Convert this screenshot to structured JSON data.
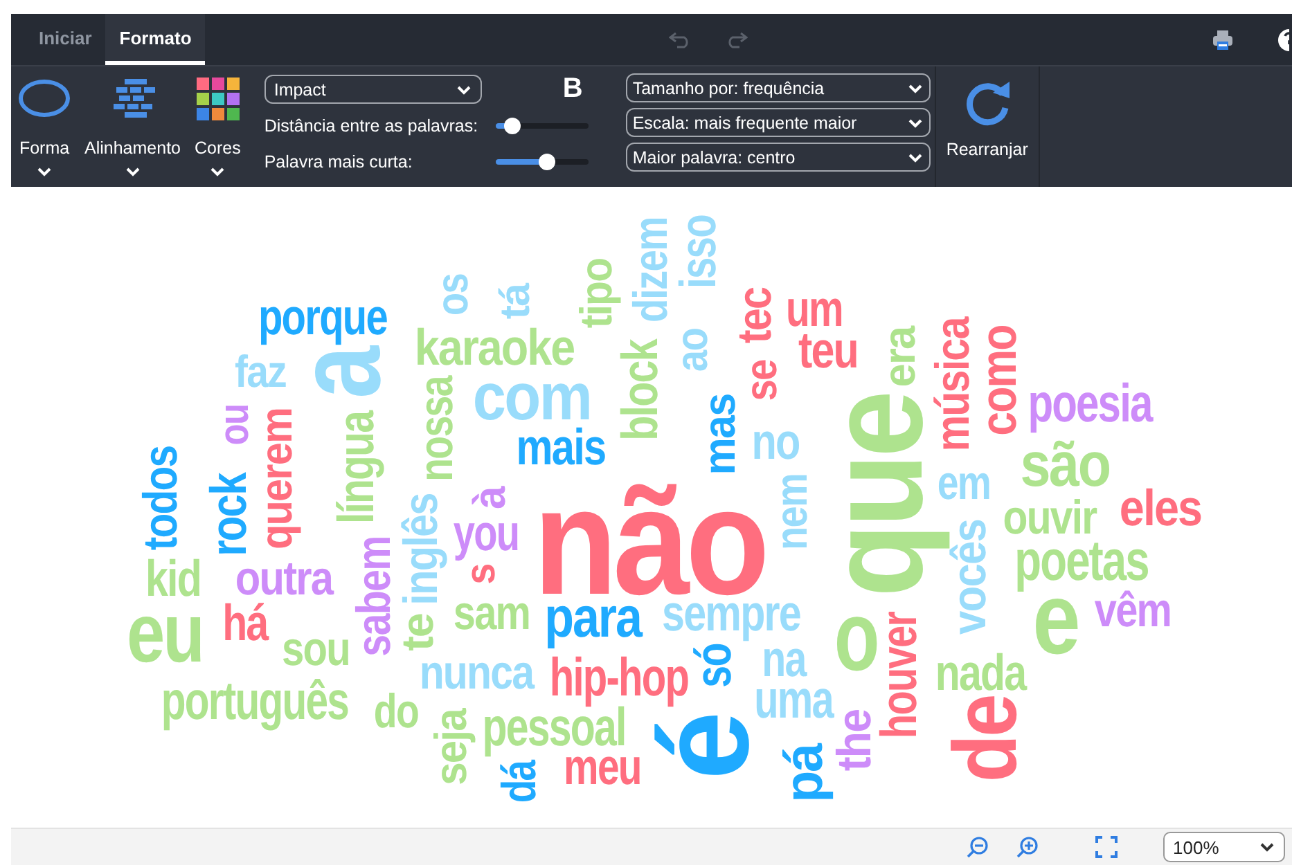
{
  "tabs": [
    {
      "label": "Iniciar",
      "selected": false
    },
    {
      "label": "Formato",
      "selected": true
    }
  ],
  "ribbon": {
    "tools": [
      {
        "label": "Forma",
        "kind": "shape"
      },
      {
        "label": "Alinhamento",
        "kind": "alignment"
      },
      {
        "label": "Cores",
        "kind": "colors"
      }
    ],
    "font": "Impact",
    "bold": "B",
    "sliders": [
      {
        "label": "Distância entre as palavras:",
        "level": 0.18
      },
      {
        "label": "Palavra mais curta:",
        "level": 0.55
      }
    ],
    "dropdowns": [
      "Tamanho por: frequência",
      "Escala: mais frequente maior",
      "Maior palavra: centro"
    ],
    "rearrange": "Rearranjar"
  },
  "cloud": {
    "words": [
      {
        "text": "porque",
        "color": "#1faaff",
        "vertical": false
      },
      {
        "text": "os",
        "color": "#99dcfb",
        "vertical": true
      },
      {
        "text": "tá",
        "color": "#99dcfb",
        "vertical": true
      },
      {
        "text": "tipo",
        "color": "#aee38e",
        "vertical": true
      },
      {
        "text": "isso",
        "color": "#99dcfb",
        "vertical": true
      },
      {
        "text": "dizem",
        "color": "#99dcfb",
        "vertical": true
      },
      {
        "text": "faz",
        "color": "#99dcfb",
        "vertical": false
      },
      {
        "text": "a",
        "color": "#99dcfb",
        "vertical": true
      },
      {
        "text": "karaoke",
        "color": "#aee38e",
        "vertical": false
      },
      {
        "text": "ao",
        "color": "#99dcfb",
        "vertical": true
      },
      {
        "text": "tec",
        "color": "#ff6e7f",
        "vertical": true
      },
      {
        "text": "um",
        "color": "#ff6e7f",
        "vertical": false
      },
      {
        "text": "todos",
        "color": "#1faaff",
        "vertical": true
      },
      {
        "text": "querem",
        "color": "#ff6e7f",
        "vertical": true
      },
      {
        "text": "ou",
        "color": "#cd8cf9",
        "vertical": true
      },
      {
        "text": "rock",
        "color": "#1faaff",
        "vertical": true
      },
      {
        "text": "língua",
        "color": "#aee38e",
        "vertical": true
      },
      {
        "text": "nossa",
        "color": "#aee38e",
        "vertical": true
      },
      {
        "text": "com",
        "color": "#99dcfb",
        "vertical": false
      },
      {
        "text": "mais",
        "color": "#1faaff",
        "vertical": false
      },
      {
        "text": "block",
        "color": "#aee38e",
        "vertical": true
      },
      {
        "text": "se",
        "color": "#ff6e7f",
        "vertical": true
      },
      {
        "text": "teu",
        "color": "#ff6e7f",
        "vertical": false
      },
      {
        "text": "mas",
        "color": "#1faaff",
        "vertical": true
      },
      {
        "text": "no",
        "color": "#99dcfb",
        "vertical": false
      },
      {
        "text": "música",
        "color": "#ff6e7f",
        "vertical": true
      },
      {
        "text": "era",
        "color": "#aee38e",
        "vertical": true
      },
      {
        "text": "kid",
        "color": "#aee38e",
        "vertical": false
      },
      {
        "text": "eu",
        "color": "#aee38e",
        "vertical": false
      },
      {
        "text": "outra",
        "color": "#cd8cf9",
        "vertical": false
      },
      {
        "text": "há",
        "color": "#ff6e7f",
        "vertical": false
      },
      {
        "text": "inglês",
        "color": "#99dcfb",
        "vertical": true
      },
      {
        "text": "sabem",
        "color": "#cd8cf9",
        "vertical": true
      },
      {
        "text": "you",
        "color": "#cd8cf9",
        "vertical": false
      },
      {
        "text": "à",
        "color": "#cd8cf9",
        "vertical": true
      },
      {
        "text": "s",
        "color": "#ff6e7f",
        "vertical": true
      },
      {
        "text": "sou",
        "color": "#aee38e",
        "vertical": false
      },
      {
        "text": "te",
        "color": "#aee38e",
        "vertical": true
      },
      {
        "text": "sam",
        "color": "#aee38e",
        "vertical": false
      },
      {
        "text": "português",
        "color": "#aee38e",
        "vertical": false
      },
      {
        "text": "do",
        "color": "#aee38e",
        "vertical": false
      },
      {
        "text": "nunca",
        "color": "#99dcfb",
        "vertical": false
      },
      {
        "text": "não",
        "color": "#ff6e7f",
        "vertical": false
      },
      {
        "text": "para",
        "color": "#1faaff",
        "vertical": false
      },
      {
        "text": "que",
        "color": "#aee38e",
        "vertical": true
      },
      {
        "text": "como",
        "color": "#ff6e7f",
        "vertical": true
      },
      {
        "text": "poesia",
        "color": "#cd8cf9",
        "vertical": false
      },
      {
        "text": "nem",
        "color": "#99dcfb",
        "vertical": true
      },
      {
        "text": "em",
        "color": "#99dcfb",
        "vertical": false
      },
      {
        "text": "são",
        "color": "#aee38e",
        "vertical": false
      },
      {
        "text": "sempre",
        "color": "#99dcfb",
        "vertical": false
      },
      {
        "text": "só",
        "color": "#1faaff",
        "vertical": true
      },
      {
        "text": "hip-hop",
        "color": "#ff6e7f",
        "vertical": false
      },
      {
        "text": "na",
        "color": "#99dcfb",
        "vertical": false
      },
      {
        "text": "seja",
        "color": "#aee38e",
        "vertical": true
      },
      {
        "text": "pessoal",
        "color": "#aee38e",
        "vertical": false
      },
      {
        "text": "uma",
        "color": "#99dcfb",
        "vertical": false
      },
      {
        "text": "o",
        "color": "#aee38e",
        "vertical": false
      },
      {
        "text": "dá",
        "color": "#1faaff",
        "vertical": true
      },
      {
        "text": "é",
        "color": "#1faaff",
        "vertical": true
      },
      {
        "text": "houver",
        "color": "#ff6e7f",
        "vertical": true
      },
      {
        "text": "vocês",
        "color": "#99dcfb",
        "vertical": true
      },
      {
        "text": "ouvir",
        "color": "#aee38e",
        "vertical": false
      },
      {
        "text": "eles",
        "color": "#ff6e7f",
        "vertical": false
      },
      {
        "text": "meu",
        "color": "#ff6e7f",
        "vertical": false
      },
      {
        "text": "the",
        "color": "#cd8cf9",
        "vertical": true
      },
      {
        "text": "poetas",
        "color": "#aee38e",
        "vertical": false
      },
      {
        "text": "nada",
        "color": "#aee38e",
        "vertical": false
      },
      {
        "text": "e",
        "color": "#aee38e",
        "vertical": false
      },
      {
        "text": "vêm",
        "color": "#cd8cf9",
        "vertical": false
      },
      {
        "text": "pá",
        "color": "#1faaff",
        "vertical": true
      },
      {
        "text": "de",
        "color": "#ff6e7f",
        "vertical": true
      }
    ]
  },
  "zoom": {
    "value": "100%"
  }
}
